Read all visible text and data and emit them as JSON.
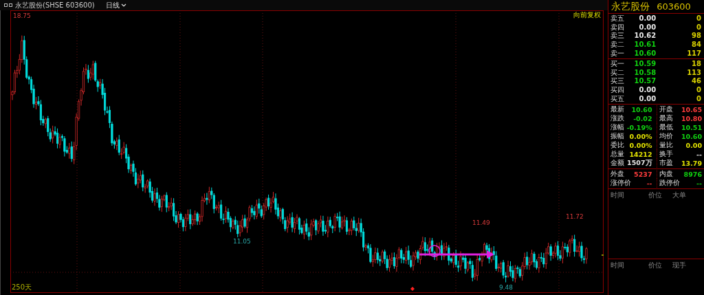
{
  "header": {
    "title": "永艺股份(SHSE 603600)",
    "period": "日线"
  },
  "chart": {
    "adjust": "向前复权",
    "range": "250天",
    "labels": [
      {
        "text": "18.75",
        "color": "#d83a3a"
      },
      {
        "text": "11.05",
        "color": "#2aa8a8"
      },
      {
        "text": "11.49",
        "color": "#d83a3a"
      },
      {
        "text": "9.48",
        "color": "#2aa8a8"
      },
      {
        "text": "11.72",
        "color": "#d83a3a"
      }
    ]
  },
  "quote": {
    "name": "永艺股份",
    "code": "603600",
    "asks": [
      {
        "label": "卖五",
        "price": "0.00",
        "color": "#e6e6e6",
        "volume": "0"
      },
      {
        "label": "卖四",
        "price": "0.00",
        "color": "#e6e6e6",
        "volume": "0"
      },
      {
        "label": "卖三",
        "price": "10.62",
        "color": "#e6e6e6",
        "volume": "98"
      },
      {
        "label": "卖二",
        "price": "10.61",
        "color": "#10d010",
        "volume": "84"
      },
      {
        "label": "卖一",
        "price": "10.60",
        "color": "#10d010",
        "volume": "117"
      }
    ],
    "bids": [
      {
        "label": "买一",
        "price": "10.59",
        "color": "#10d010",
        "volume": "18"
      },
      {
        "label": "买二",
        "price": "10.58",
        "color": "#10d010",
        "volume": "113"
      },
      {
        "label": "买三",
        "price": "10.57",
        "color": "#10d010",
        "volume": "46"
      },
      {
        "label": "买四",
        "price": "0.00",
        "color": "#e6e6e6",
        "volume": "0"
      },
      {
        "label": "买五",
        "price": "0.00",
        "color": "#e6e6e6",
        "volume": "0"
      }
    ],
    "stats": [
      {
        "label": "最新",
        "value": "10.60",
        "color": "#10d010"
      },
      {
        "label": "开盘",
        "value": "10.65",
        "color": "#ff3c3c"
      },
      {
        "label": "涨跌",
        "value": "-0.02",
        "color": "#10d010"
      },
      {
        "label": "最高",
        "value": "10.80",
        "color": "#ff3c3c"
      },
      {
        "label": "涨幅",
        "value": "-0.19%",
        "color": "#10d010"
      },
      {
        "label": "最低",
        "value": "10.51",
        "color": "#10d010"
      },
      {
        "label": "振幅",
        "value": "0.00%",
        "color": "#e0e000"
      },
      {
        "label": "均价",
        "value": "10.60",
        "color": "#10d010"
      },
      {
        "label": "委比",
        "value": "0.00%",
        "color": "#e0e000"
      },
      {
        "label": "量比",
        "value": "0.00",
        "color": "#e0e000"
      },
      {
        "label": "总量",
        "value": "14212",
        "color": "#e0e000"
      },
      {
        "label": "换手",
        "value": "--",
        "color": "#e6e6e6"
      },
      {
        "label": "金额",
        "value": "1507万",
        "color": "#e6e6e6"
      },
      {
        "label": "市盈",
        "value": "13.79",
        "color": "#e0e000"
      }
    ],
    "flow": [
      {
        "label": "外盘",
        "value": "5237",
        "color": "#ff3c3c"
      },
      {
        "label": "内盘",
        "value": "8976",
        "color": "#10d010"
      },
      {
        "label": "涨停价",
        "value": "--",
        "color": "#ff3c3c"
      },
      {
        "label": "跌停价",
        "value": "--",
        "color": "#10d010"
      }
    ],
    "big_orders": {
      "columns": [
        "时间",
        "价位",
        "大单"
      ]
    },
    "ticks": {
      "columns": [
        "时间",
        "价位",
        "现手"
      ]
    }
  }
}
